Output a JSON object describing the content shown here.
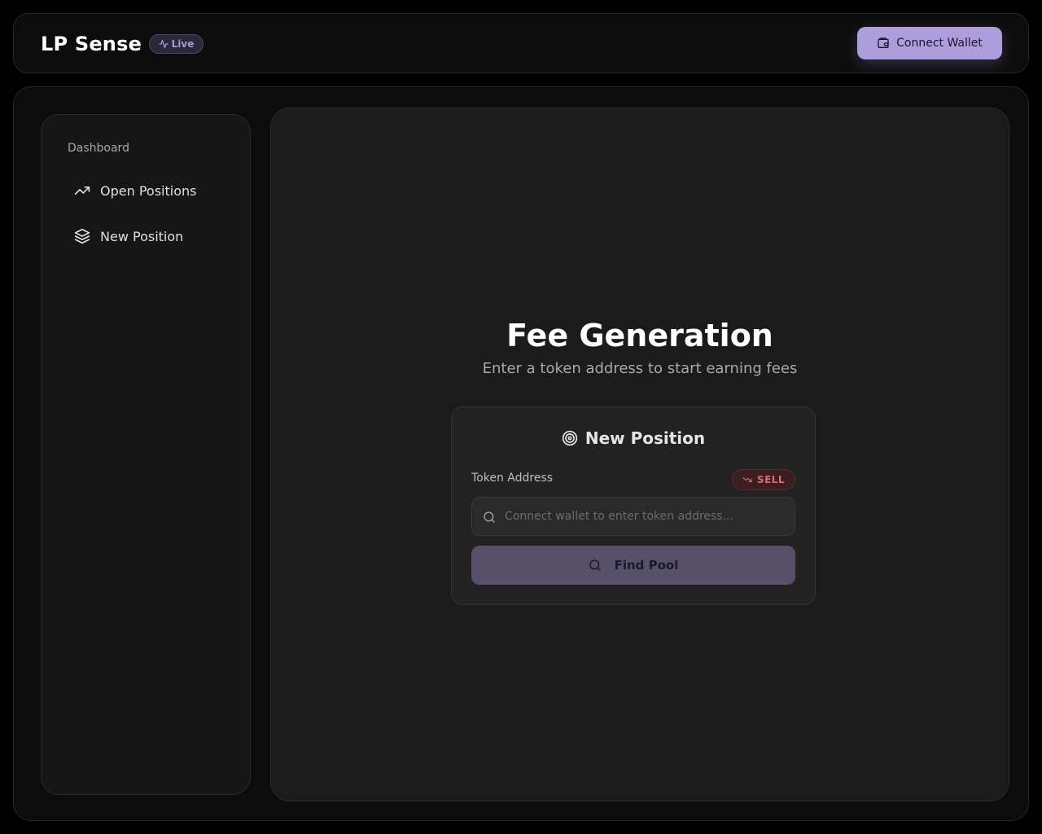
{
  "header": {
    "brand": "LP Sense",
    "live_label": "Live",
    "connect_label": "Connect Wallet"
  },
  "sidebar": {
    "heading": "Dashboard",
    "items": [
      {
        "label": "Open Positions",
        "icon": "trending-up-icon"
      },
      {
        "label": "New Position",
        "icon": "layers-icon"
      }
    ]
  },
  "main": {
    "title": "Fee Generation",
    "subtitle": "Enter a token address to start earning fees",
    "card": {
      "title": "New Position",
      "title_icon": "target-icon",
      "field_label": "Token Address",
      "side_badge": "SELL",
      "input_placeholder": "Connect wallet to enter token address...",
      "input_value": "",
      "find_label": "Find Pool"
    }
  },
  "colors": {
    "accent": "#ad9ddd",
    "sell": "#e26a72",
    "background": "#000000",
    "panel": "#1b1b1b"
  }
}
